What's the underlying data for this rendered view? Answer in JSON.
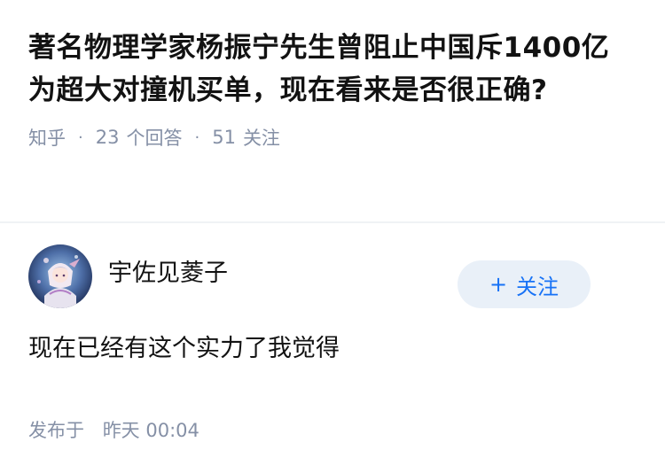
{
  "question": {
    "title": "著名物理学家杨振宁先生曾阻止中国斥1400亿为超大对撞机买单，现在看来是否很正确?",
    "meta": {
      "source": "知乎",
      "separator": "·",
      "answer_count": "23",
      "answer_label": "个回答",
      "follow_count": "51",
      "follow_label": "关注"
    }
  },
  "answer": {
    "author": {
      "name": "宇佐见菱子",
      "avatar_icon": "anime-avatar"
    },
    "follow_button": {
      "plus": "+",
      "label": "关注"
    },
    "content": "现在已经有这个实力了我觉得",
    "time": {
      "label": "发布于",
      "value": "昨天 00:04"
    }
  },
  "colors": {
    "text_primary": "#121212",
    "text_secondary": "#8590a6",
    "accent": "#1772f6",
    "follow_bg": "#e9f0f8",
    "divider": "#f0f2f5"
  }
}
